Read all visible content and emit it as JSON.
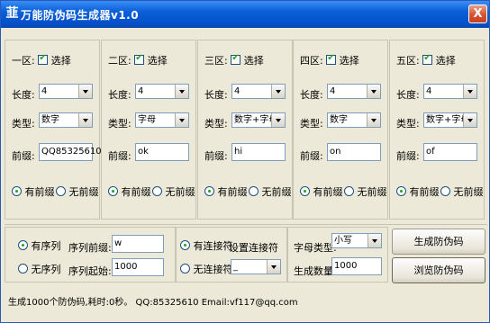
{
  "window": {
    "title": "万能防伪码生成器v1.0",
    "app_icon_glyph": "韮",
    "close_glyph": "X"
  },
  "zones": [
    {
      "name": "一区:",
      "select_label": "选择",
      "checked": true,
      "length_label": "长度:",
      "length_value": "4",
      "type_label": "类型:",
      "type_value": "数字",
      "prefix_label": "前缀:",
      "prefix_value": "QQ85325610",
      "has_prefix_label": "有前缀",
      "no_prefix_label": "无前缀",
      "has_prefix_selected": true
    },
    {
      "name": "二区:",
      "select_label": "选择",
      "checked": true,
      "length_label": "长度:",
      "length_value": "4",
      "type_label": "类型:",
      "type_value": "字母",
      "prefix_label": "前缀:",
      "prefix_value": "ok",
      "has_prefix_label": "有前缀",
      "no_prefix_label": "无前缀",
      "has_prefix_selected": true
    },
    {
      "name": "三区:",
      "select_label": "选择",
      "checked": true,
      "length_label": "长度:",
      "length_value": "4",
      "type_label": "类型:",
      "type_value": "数字+字母",
      "prefix_label": "前缀:",
      "prefix_value": "hi",
      "has_prefix_label": "有前缀",
      "no_prefix_label": "无前缀",
      "has_prefix_selected": true
    },
    {
      "name": "四区:",
      "select_label": "选择",
      "checked": true,
      "length_label": "长度:",
      "length_value": "4",
      "type_label": "类型:",
      "type_value": "数字",
      "prefix_label": "前缀:",
      "prefix_value": "on",
      "has_prefix_label": "有前缀",
      "no_prefix_label": "无前缀",
      "has_prefix_selected": true
    },
    {
      "name": "五区:",
      "select_label": "选择",
      "checked": true,
      "length_label": "长度:",
      "length_value": "4",
      "type_label": "类型:",
      "type_value": "数字+字母",
      "prefix_label": "前缀:",
      "prefix_value": "of",
      "has_prefix_label": "有前缀",
      "no_prefix_label": "无前缀",
      "has_prefix_selected": true
    }
  ],
  "sequence": {
    "has_seq_label": "有序列",
    "no_seq_label": "无序列",
    "has_seq_selected": true,
    "prefix_label": "序列前缀:",
    "prefix_value": "w",
    "start_label": "序列起始:",
    "start_value": "1000"
  },
  "connector": {
    "has_conn_label": "有连接符",
    "no_conn_label": "无连接符",
    "has_conn_selected": true,
    "set_label": "设置连接符",
    "conn_value": "_"
  },
  "letters": {
    "case_label": "字母类型:",
    "case_value": "小写",
    "count_label": "生成数量:",
    "count_value": "1000"
  },
  "buttons": {
    "generate": "生成防伪码",
    "browse": "浏览防伪码"
  },
  "status": "生成1000个防伪码,耗时:0秒。 QQ:85325610   Email:vf117@qq.com"
}
